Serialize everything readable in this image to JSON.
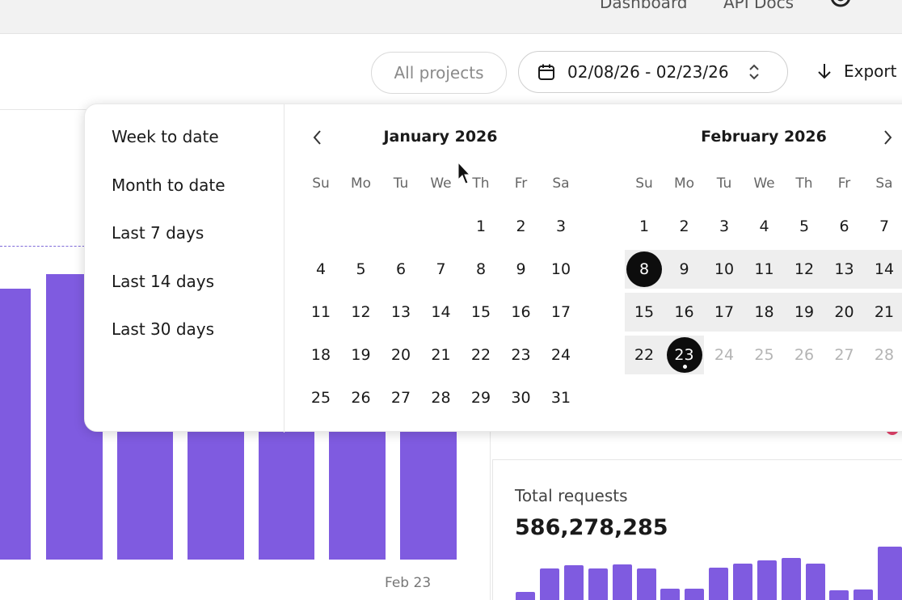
{
  "topnav": {
    "links": [
      "Dashboard",
      "API Docs"
    ],
    "settings_icon": "gear-icon"
  },
  "toolbar": {
    "projects_label": "All projects",
    "date_range": "02/08/26 - 02/23/26",
    "calendar_icon": "calendar-icon",
    "sort_icon": "chevron-updown-icon",
    "export_label": "Export",
    "export_icon": "arrow-down-icon"
  },
  "date_picker": {
    "presets": [
      "Week to date",
      "Month to date",
      "Last 7 days",
      "Last 14 days",
      "Last 30 days"
    ],
    "weekdays": [
      "Su",
      "Mo",
      "Tu",
      "We",
      "Th",
      "Fr",
      "Sa"
    ],
    "months": [
      {
        "title": "January 2026",
        "weeks": [
          [
            "",
            "",
            "",
            "",
            "1",
            "2",
            "3"
          ],
          [
            "4",
            "5",
            "6",
            "7",
            "8",
            "9",
            "10"
          ],
          [
            "11",
            "12",
            "13",
            "14",
            "15",
            "16",
            "17"
          ],
          [
            "18",
            "19",
            "20",
            "21",
            "22",
            "23",
            "24"
          ],
          [
            "25",
            "26",
            "27",
            "28",
            "29",
            "30",
            "31"
          ]
        ]
      },
      {
        "title": "February 2026",
        "weeks": [
          [
            "1",
            "2",
            "3",
            "4",
            "5",
            "6",
            "7"
          ],
          [
            "8",
            "9",
            "10",
            "11",
            "12",
            "13",
            "14"
          ],
          [
            "15",
            "16",
            "17",
            "18",
            "19",
            "20",
            "21"
          ],
          [
            "22",
            "23",
            "24",
            "25",
            "26",
            "27",
            "28"
          ]
        ],
        "range_start": "8",
        "range_end": "23",
        "today": "23",
        "disabled_after": "23"
      }
    ],
    "prev_icon": "chevron-left-icon",
    "next_icon": "chevron-right-icon"
  },
  "chart": {
    "x_label": "Feb 23",
    "bar_color": "#7f5be0"
  },
  "requests_panel": {
    "title": "Total requests",
    "value": "586,278,285",
    "bar_color": "#7f5be0"
  },
  "colors": {
    "accent": "#7f5be0",
    "selected_day": "#0d0d0d",
    "range_bg": "#eeeeee",
    "alert": "#e3426b"
  }
}
